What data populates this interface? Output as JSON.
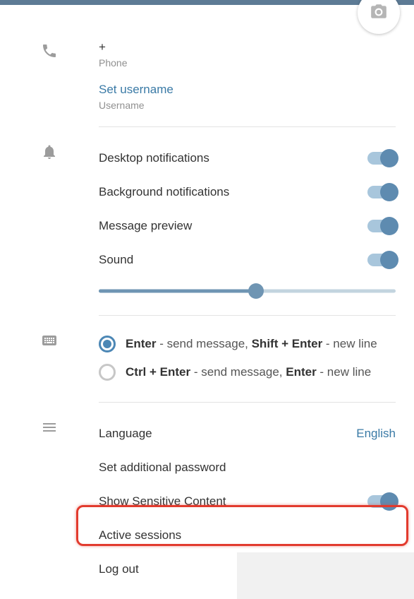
{
  "profile": {
    "phone_value": "+",
    "phone_label": "Phone",
    "set_username": "Set username",
    "username_label": "Username"
  },
  "notifications": {
    "desktop": "Desktop notifications",
    "background": "Background notifications",
    "preview": "Message preview",
    "sound": "Sound"
  },
  "send": {
    "opt1": {
      "k1": "Enter",
      "t1": " - send message, ",
      "k2": "Shift + Enter",
      "t2": " - new line"
    },
    "opt2": {
      "k1": "Ctrl + Enter",
      "t1": " - send message, ",
      "k2": "Enter",
      "t2": " - new line"
    }
  },
  "general": {
    "language_label": "Language",
    "language_value": "English",
    "additional_password": "Set additional password",
    "sensitive": "Show Sensitive Content",
    "active_sessions": "Active sessions",
    "logout": "Log out"
  }
}
